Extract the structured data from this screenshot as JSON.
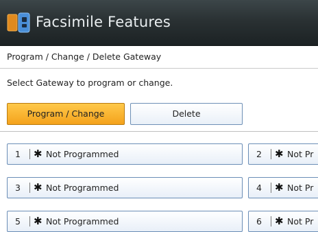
{
  "window": {
    "title": "Facsimile Features",
    "icon": "facsimile-app-icon"
  },
  "header": {
    "breadcrumb": "Program / Change / Delete Gateway"
  },
  "main": {
    "instruction": "Select Gateway to program or change.",
    "modes": [
      {
        "label": "Program / Change",
        "selected": true
      },
      {
        "label": "Delete",
        "selected": false
      }
    ],
    "gateways": [
      {
        "number": "1",
        "marker": "✱",
        "label": "Not Programmed"
      },
      {
        "number": "2",
        "marker": "✱",
        "label": "Not Pr"
      },
      {
        "number": "3",
        "marker": "✱",
        "label": "Not Programmed"
      },
      {
        "number": "4",
        "marker": "✱",
        "label": "Not Pr"
      },
      {
        "number": "5",
        "marker": "✱",
        "label": "Not Programmed"
      },
      {
        "number": "6",
        "marker": "✱",
        "label": "Not Pr"
      }
    ]
  },
  "colors": {
    "title_bar": "#2a3133",
    "selected_mode": "#f4a21c",
    "button_border": "#6a8db6"
  }
}
